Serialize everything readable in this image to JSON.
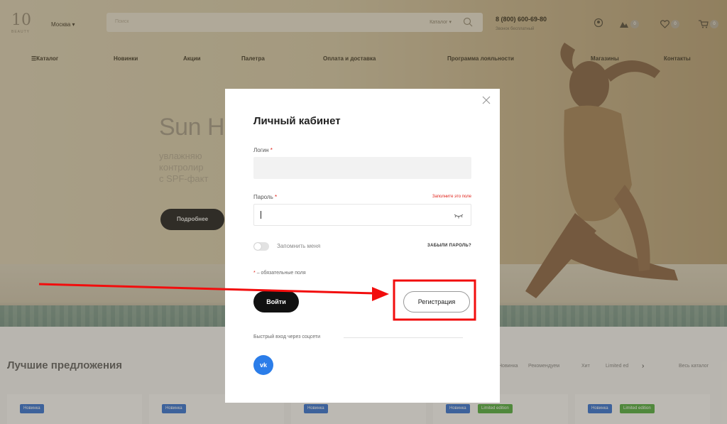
{
  "header": {
    "logo_text": "10",
    "logo_sub": "BEAUTY",
    "city": "Москва",
    "search_placeholder": "Поиск",
    "search_category": "Каталог",
    "phone": "8 (800) 600-69-80",
    "phone_note": "Звонок бесплатный",
    "compare_count": "0",
    "favorites_count": "0",
    "cart_count": "0"
  },
  "nav": {
    "items": [
      "Каталог",
      "Новинки",
      "Акции",
      "Палетра",
      "Оплата и доставка",
      "Программа лояльности",
      "Магазины",
      "Контакты"
    ]
  },
  "hero": {
    "title": "Sun Hi",
    "subtitle_lines": [
      "увлажняю",
      "контролир",
      "с SPF-факт"
    ],
    "button": "Подробнее"
  },
  "best": {
    "title": "Лучшие предложения",
    "tabs": [
      "Новинка",
      "Рекомендуем",
      "Хит",
      "Limited ed"
    ],
    "see_all": "Весь каталог",
    "tags": [
      "Новинка",
      "Новинка",
      "Новинка",
      "Новинка",
      "Limited edition",
      "Новинка",
      "Limited edition"
    ]
  },
  "modal": {
    "title": "Личный кабинет",
    "login_label": "Логин",
    "password_label": "Пароль",
    "required_star": "*",
    "fill_hint": "Заполните это поле",
    "remember_label": "Запомнить меня",
    "forgot_label": "ЗАБЫЛИ ПАРОЛЬ?",
    "required_note": "– обязательные поля",
    "login_button": "Войти",
    "register_button": "Регистрация",
    "social_label": "Быстрый вход через соцсети",
    "vk_label": "vk"
  },
  "colors": {
    "accent_red": "#e0241b",
    "vk_blue": "#2b7de9",
    "tag_blue": "#3e79d6",
    "tag_green": "#5bb24a"
  }
}
